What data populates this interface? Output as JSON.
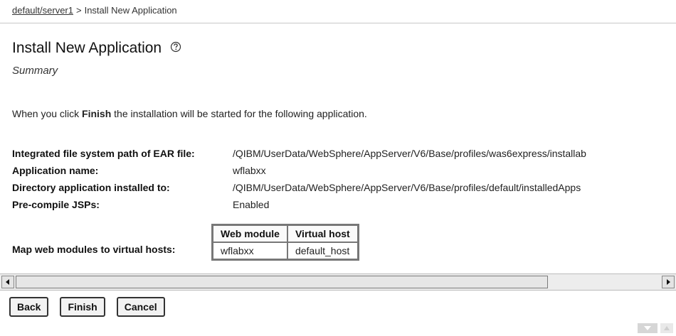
{
  "breadcrumb": {
    "link": "default/server1",
    "separator": ">",
    "current": "Install New Application"
  },
  "page": {
    "title": "Install New Application",
    "subtitle": "Summary",
    "intro_prefix": "When you click ",
    "intro_bold": "Finish",
    "intro_suffix": " the installation will be started for the following application."
  },
  "summary": [
    {
      "label": "Integrated file system path of EAR file:",
      "value": "/QIBM/UserData/WebSphere/AppServer/V6/Base/profiles/was6express/installab"
    },
    {
      "label": "Application name:",
      "value": "wflabxx"
    },
    {
      "label": "Directory application installed to:",
      "value": "/QIBM/UserData/WebSphere/AppServer/V6/Base/profiles/default/installedApps"
    },
    {
      "label": "Pre-compile JSPs:",
      "value": "Enabled"
    }
  ],
  "mapping": {
    "label": "Map web modules to virtual hosts:",
    "headers": [
      "Web module",
      "Virtual host"
    ],
    "rows": [
      [
        "wflabxx",
        "default_host"
      ]
    ]
  },
  "buttons": {
    "back": "Back",
    "finish": "Finish",
    "cancel": "Cancel"
  },
  "icons": {
    "help": "help-icon",
    "scroll_left": "arrow-left-icon",
    "scroll_right": "arrow-right-icon",
    "collapse": "chevron-down-icon"
  },
  "colors": {
    "button_border": "#333333",
    "rule": "#c8c8c8"
  }
}
